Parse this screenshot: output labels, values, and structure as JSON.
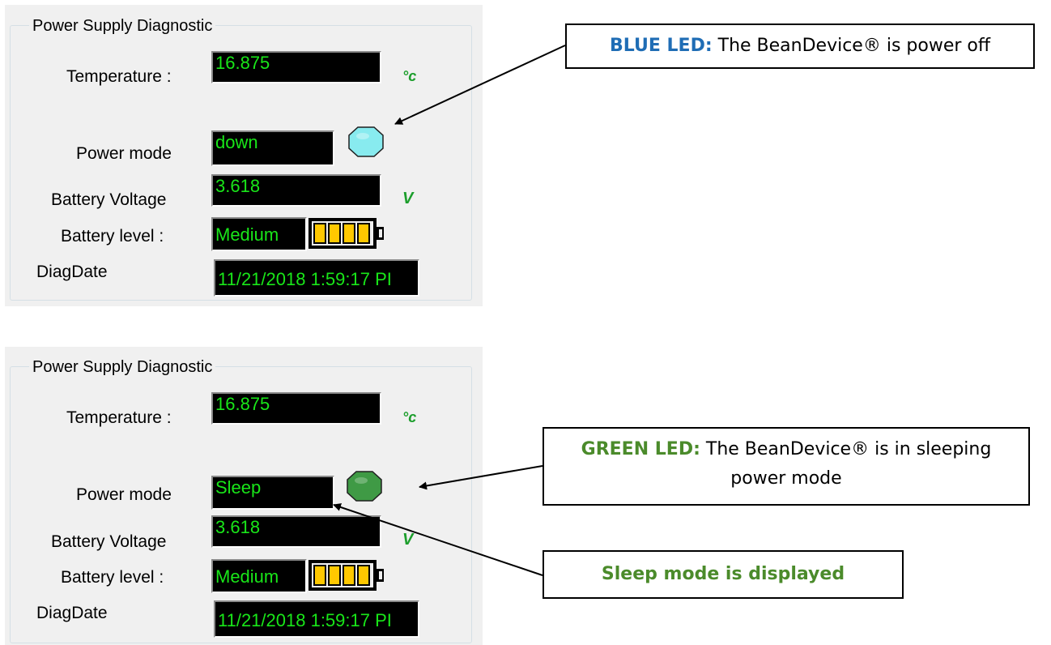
{
  "panels": [
    {
      "title": "Power Supply Diagnostic",
      "temperature_label": "Temperature :",
      "temperature_value": "16.875",
      "temperature_unit": "°c",
      "power_mode_label": "Power mode",
      "power_mode_value": "down",
      "led_color": "#88ebef",
      "battery_voltage_label": "Battery Voltage",
      "battery_voltage_value": "3.618",
      "battery_voltage_unit": "V",
      "battery_level_label": "Battery level :",
      "battery_level_value": "Medium",
      "battery_level_bars": 4,
      "diag_date_label": "DiagDate",
      "diag_date_value": "11/21/2018 1:59:17 PI"
    },
    {
      "title": "Power Supply Diagnostic",
      "temperature_label": "Temperature :",
      "temperature_value": "16.875",
      "temperature_unit": "°c",
      "power_mode_label": "Power mode",
      "power_mode_value": "Sleep",
      "led_color": "#3f9a45",
      "battery_voltage_label": "Battery Voltage",
      "battery_voltage_value": "3.618",
      "battery_voltage_unit": "V",
      "battery_level_label": "Battery level :",
      "battery_level_value": "Medium",
      "battery_level_bars": 4,
      "diag_date_label": "DiagDate",
      "diag_date_value": "11/21/2018 1:59:17 PI"
    }
  ],
  "callouts": {
    "blue": {
      "tag": "BLUE LED:",
      "text": " The BeanDevice® is power off"
    },
    "green": {
      "tag": "GREEN LED:",
      "text": " The BeanDevice® is in sleeping power mode"
    },
    "sleep": {
      "text": "Sleep mode is displayed"
    }
  },
  "colors": {
    "lcd_text": "#19e619",
    "unit_text": "#1c9e2c",
    "blue_tag": "#1f6db5",
    "green_tag": "#4b8b2b",
    "battery_fill": "#ffc800"
  }
}
